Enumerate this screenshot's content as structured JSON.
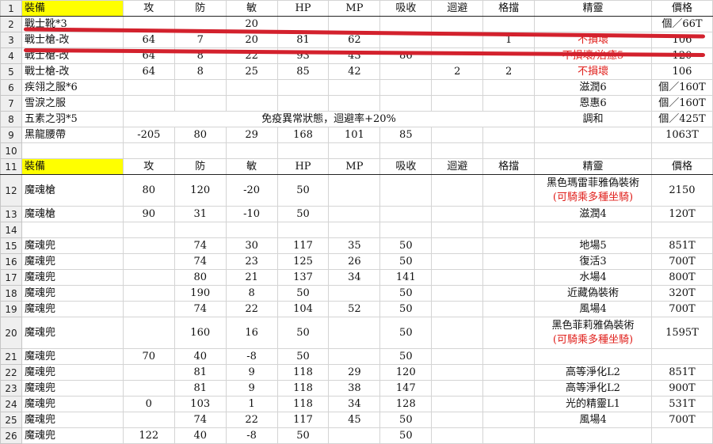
{
  "rows": [
    {
      "n": "1",
      "hdr": true,
      "c": [
        "裝備",
        "攻",
        "防",
        "敏",
        "HP",
        "MP",
        "吸收",
        "迴避",
        "格擋",
        "精靈",
        "價格"
      ]
    },
    {
      "n": "2",
      "c": [
        "戰士靴*3",
        "",
        "",
        "20",
        "",
        "",
        "",
        "",
        "",
        "",
        "個／66T"
      ]
    },
    {
      "n": "3",
      "c": [
        "戰士槍-改",
        "64",
        "7",
        "20",
        "81",
        "62",
        "",
        "",
        "1",
        "不損壞",
        "106"
      ],
      "red": [
        9
      ]
    },
    {
      "n": "4",
      "c": [
        "戰士槍-改",
        "64",
        "8",
        "22",
        "93",
        "43",
        "86",
        "",
        "",
        "不損壞/治癒5",
        "120"
      ],
      "red": [
        9
      ]
    },
    {
      "n": "5",
      "c": [
        "戰士槍-改",
        "64",
        "8",
        "25",
        "85",
        "42",
        "",
        "2",
        "2",
        "不損壞",
        "106"
      ],
      "red": [
        9
      ]
    },
    {
      "n": "6",
      "c": [
        "疾翎之服*6",
        "",
        "",
        "",
        "",
        "",
        "",
        "",
        "",
        "滋潤6",
        "個／160T"
      ]
    },
    {
      "n": "7",
      "c": [
        "雪淚之服",
        "",
        "",
        "",
        "",
        "",
        "",
        "",
        "",
        "恩惠6",
        "個／160T"
      ]
    },
    {
      "n": "8",
      "note": "免疫異常狀態，迴避率+20%",
      "c": [
        "五素之羽*5",
        "",
        "",
        "",
        "",
        "",
        "",
        "",
        "",
        "調和",
        "個／425T"
      ]
    },
    {
      "n": "9",
      "c": [
        "黑龍腰帶",
        "-205",
        "80",
        "29",
        "168",
        "101",
        "85",
        "",
        "",
        "",
        "1063T"
      ]
    },
    {
      "n": "10",
      "c": [
        "",
        "",
        "",
        "",
        "",
        "",
        "",
        "",
        "",
        "",
        ""
      ]
    },
    {
      "n": "11",
      "hdr": true,
      "c": [
        "裝備",
        "攻",
        "防",
        "敏",
        "HP",
        "MP",
        "吸收",
        "迴避",
        "格擋",
        "精靈",
        "價格"
      ]
    },
    {
      "n": "12",
      "tall": true,
      "c": [
        "魔魂槍",
        "80",
        "120",
        "-20",
        "50",
        "",
        "",
        "",
        "",
        "",
        ""
      ],
      "sp1": "黑色瑪雷菲雅偽裝術",
      "sp2": "(可騎乘多種坐騎)",
      "price": "2150"
    },
    {
      "n": "13",
      "c": [
        "魔魂槍",
        "90",
        "31",
        "-10",
        "50",
        "",
        "",
        "",
        "",
        "滋潤4",
        "120T"
      ]
    },
    {
      "n": "14",
      "c": [
        "",
        "",
        "",
        "",
        "",
        "",
        "",
        "",
        "",
        "",
        ""
      ]
    },
    {
      "n": "15",
      "c": [
        "魔魂兜",
        "",
        "74",
        "30",
        "117",
        "35",
        "50",
        "",
        "",
        "地場5",
        "851T"
      ]
    },
    {
      "n": "16",
      "c": [
        "魔魂兜",
        "",
        "74",
        "23",
        "125",
        "26",
        "50",
        "",
        "",
        "復活3",
        "700T"
      ]
    },
    {
      "n": "17",
      "c": [
        "魔魂兜",
        "",
        "80",
        "21",
        "137",
        "34",
        "141",
        "",
        "",
        "水場4",
        "800T"
      ]
    },
    {
      "n": "18",
      "c": [
        "魔魂兜",
        "",
        "190",
        "8",
        "50",
        "",
        "50",
        "",
        "",
        "近藏偽裝術",
        "320T"
      ]
    },
    {
      "n": "19",
      "c": [
        "魔魂兜",
        "",
        "74",
        "22",
        "104",
        "52",
        "50",
        "",
        "",
        "風場4",
        "700T"
      ]
    },
    {
      "n": "20",
      "tall": true,
      "c": [
        "魔魂兜",
        "",
        "160",
        "16",
        "50",
        "",
        "50",
        "",
        "",
        "",
        ""
      ],
      "sp1": "黑色菲莉雅偽裝術",
      "sp2": "(可騎乘多種坐騎)",
      "price": "1595T"
    },
    {
      "n": "21",
      "c": [
        "魔魂兜",
        "70",
        "40",
        "-8",
        "50",
        "",
        "50",
        "",
        "",
        "",
        ""
      ]
    },
    {
      "n": "22",
      "c": [
        "魔魂兜",
        "",
        "81",
        "9",
        "118",
        "29",
        "120",
        "",
        "",
        "高等淨化L2",
        "851T"
      ]
    },
    {
      "n": "23",
      "c": [
        "魔魂兜",
        "",
        "81",
        "9",
        "118",
        "38",
        "147",
        "",
        "",
        "高等淨化L2",
        "900T"
      ]
    },
    {
      "n": "24",
      "c": [
        "魔魂兜",
        "0",
        "103",
        "1",
        "118",
        "34",
        "128",
        "",
        "",
        "光的精靈L1",
        "531T"
      ]
    },
    {
      "n": "25",
      "c": [
        "魔魂兜",
        "",
        "74",
        "22",
        "117",
        "45",
        "50",
        "",
        "",
        "風場4",
        "700T"
      ]
    },
    {
      "n": "26",
      "c": [
        "魔魂兜",
        "122",
        "40",
        "-8",
        "50",
        "",
        "50",
        "",
        "",
        "",
        ""
      ]
    }
  ]
}
